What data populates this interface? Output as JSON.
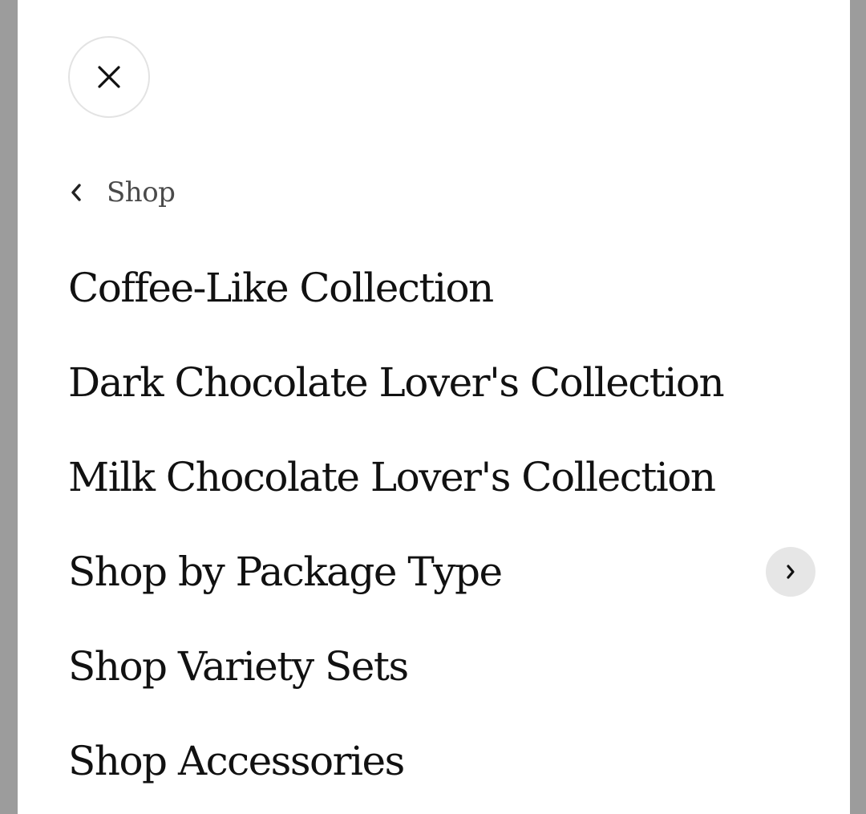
{
  "nav": {
    "close_icon": "close-icon",
    "back_label": "Shop",
    "back_icon": "chevron-left-icon"
  },
  "menu": {
    "items": [
      {
        "label": "Coffee-Like Collection",
        "has_submenu": false
      },
      {
        "label": "Dark Chocolate Lover's Collection",
        "has_submenu": false
      },
      {
        "label": "Milk Chocolate Lover's Collection",
        "has_submenu": false
      },
      {
        "label": "Shop by Package Type",
        "has_submenu": true,
        "submenu_icon": "chevron-right-icon"
      },
      {
        "label": "Shop Variety Sets",
        "has_submenu": false
      },
      {
        "label": "Shop Accessories",
        "has_submenu": false
      }
    ]
  },
  "colors": {
    "background_outer": "#9c9c9c",
    "panel": "#ffffff",
    "text": "#111111",
    "muted_text": "#4a4a4a",
    "expand_button_bg": "#e6e6e6"
  }
}
